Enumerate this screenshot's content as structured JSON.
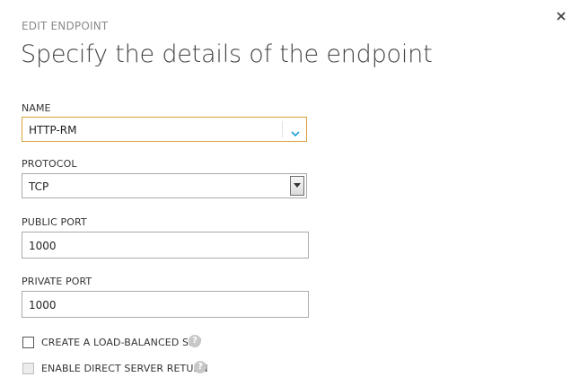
{
  "dialog": {
    "subtitle": "EDIT ENDPOINT",
    "title": "Specify the details of the endpoint",
    "close_icon": "close-icon"
  },
  "form": {
    "name": {
      "label": "NAME",
      "value": "HTTP-RM",
      "icon": "chevron-down-icon",
      "accent_color": "#d9a13c"
    },
    "protocol": {
      "label": "PROTOCOL",
      "value": "TCP",
      "icon": "chevron-down-icon"
    },
    "public_port": {
      "label": "PUBLIC PORT",
      "value": "1000"
    },
    "private_port": {
      "label": "PRIVATE PORT",
      "value": "1000"
    },
    "load_balanced": {
      "label": "CREATE A LOAD-BALANCED SET",
      "checked": false,
      "enabled": true,
      "help_icon": "help-icon"
    },
    "direct_server_return": {
      "label": "ENABLE DIRECT SERVER RETURN",
      "checked": false,
      "enabled": false,
      "help_icon": "help-icon"
    }
  }
}
